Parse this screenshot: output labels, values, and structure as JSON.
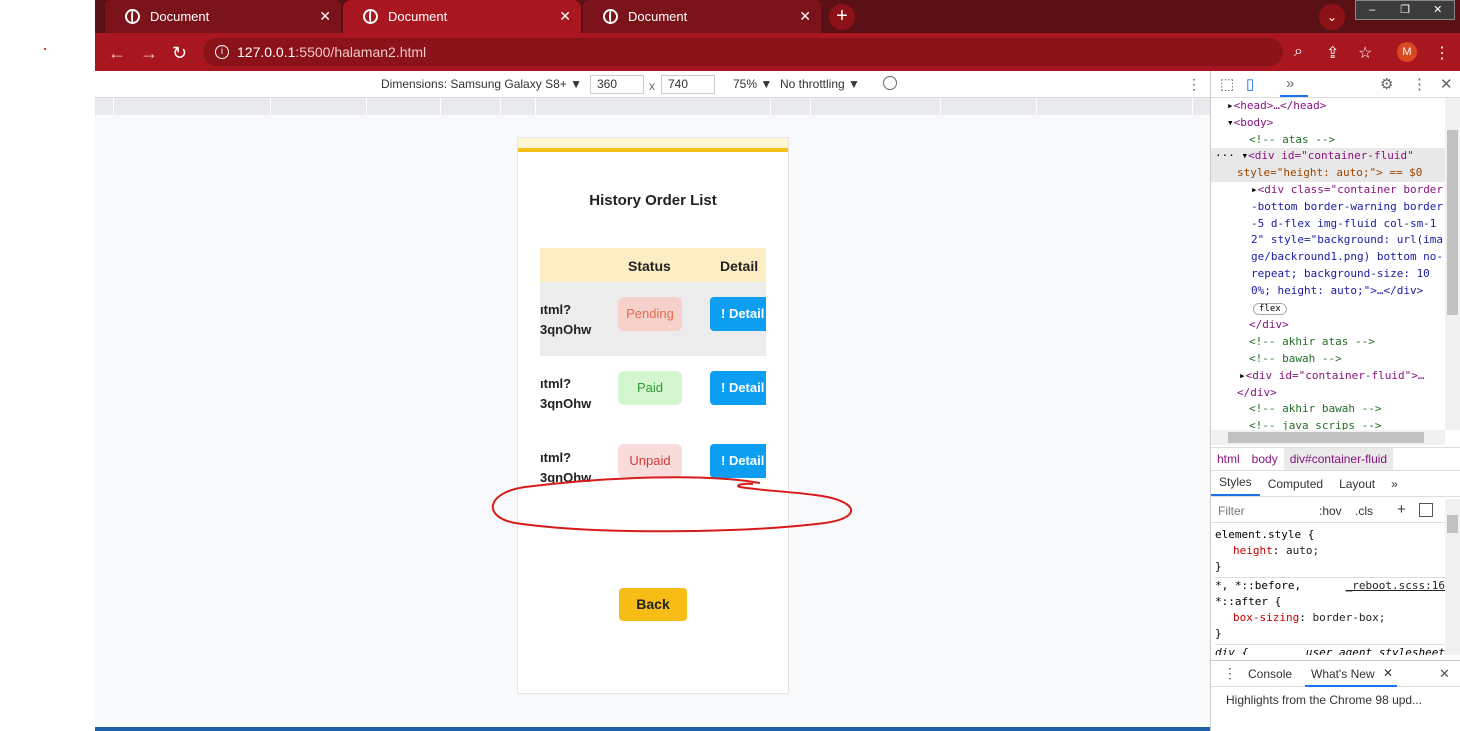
{
  "browser": {
    "tabs": [
      {
        "title": "Document"
      },
      {
        "title": "Document"
      },
      {
        "title": "Document"
      }
    ],
    "newtab_symbol": "+",
    "dropdown_symbol": "⌄",
    "window_controls": [
      "–",
      "❐",
      "✕"
    ],
    "url_host": "127.0.0.1",
    "url_path": ":5500/halaman2.html",
    "profile_initial": "M",
    "accent": "#a8171f"
  },
  "device_toolbar": {
    "dimensions_label": "Dimensions: Samsung Galaxy S8+ ▼",
    "width": "360",
    "times": "x",
    "height": "740",
    "zoom": "75% ▼",
    "throttling": "No throttling ▼"
  },
  "page": {
    "title": "History Order List",
    "headers": {
      "status": "Status",
      "detail": "Detail"
    },
    "rows": [
      {
        "order_line1": "ıtml?",
        "order_line2": "3qnOhw",
        "status": "Pending",
        "detail": "! Detail"
      },
      {
        "order_line1": "ıtml?",
        "order_line2": "3qnOhw",
        "status": "Paid",
        "detail": "! Detail"
      },
      {
        "order_line1": "ıtml?",
        "order_line2": "3qnOhw",
        "status": "Unpaid",
        "detail": "! Detail"
      }
    ],
    "back_label": "Back",
    "colors": {
      "warning": "#f7bd16",
      "info": "#0d9ef2"
    }
  },
  "devtools": {
    "tree": {
      "head": "<head>…</head>",
      "body": "<body>",
      "comment_atas": "<!-- atas -->",
      "container_open": "<div id=\"container-fluid\"",
      "container_style": "style=\"height: auto;\"> == $0",
      "child_line1": "<div class=\"container border",
      "child_line2": "-bottom border-warning border",
      "child_line3": "-5 d-flex img-fluid col-sm-1",
      "child_line4": "2\" style=\"background: url(ima",
      "child_line5": "ge/backround1.png) bottom no-",
      "child_line6": "repeat; background-size: 10",
      "child_line7": "0%; height: auto;\">…</div>",
      "flex_badge": "flex",
      "close_div": "</div>",
      "comment_akhir_atas": "<!-- akhir atas -->",
      "comment_bawah": "<!-- bawah -->",
      "container2": "<div id=\"container-fluid\">…",
      "close_div2": "</div>",
      "comment_akhir_bawah": "<!-- akhir bawah -->",
      "comment_java": "<!-- java scrips -->"
    },
    "breadcrumbs": [
      "html",
      "body",
      "div#container-fluid"
    ],
    "styles_tabs": [
      "Styles",
      "Computed",
      "Layout",
      "»"
    ],
    "filter_placeholder": "Filter",
    "hov": ":hov",
    "cls": ".cls",
    "plus": "+",
    "styles": {
      "rule1_selector": "element.style {",
      "rule1_prop": "height",
      "rule1_val": "auto;",
      "close": "}",
      "rule2_selector": "*, *::before,",
      "rule2_selector2": "*::after {",
      "rule2_source": "_reboot.scss:16",
      "rule2_prop": "box-sizing",
      "rule2_val": "border-box;",
      "rule3_selector": "div {",
      "rule3_source": "user agent stylesheet"
    },
    "drawer_tabs": [
      "Console",
      "What's New"
    ],
    "drawer_text": "Highlights from the Chrome 98 upd..."
  }
}
